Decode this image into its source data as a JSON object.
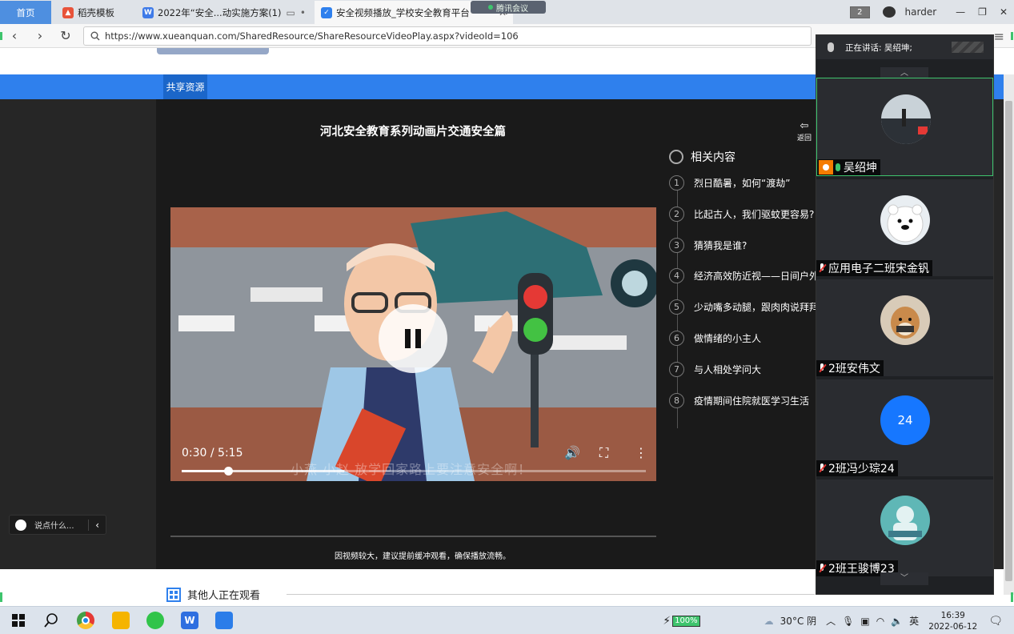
{
  "browser": {
    "tabs": [
      {
        "label": "首页",
        "kind": "home"
      },
      {
        "label": "稻壳模板",
        "kind": "normal"
      },
      {
        "label": "2022年“安全...动实施方案(1)",
        "kind": "normal"
      },
      {
        "label": "安全视频播放_学校安全教育平台",
        "kind": "active"
      }
    ],
    "meeting_pill": "腾讯会议",
    "window_count": "2",
    "user_name": "harder",
    "url": "https://www.xueanquan.com/SharedResource/ShareResourceVideoPlay.aspx?videoId=106"
  },
  "page": {
    "nav_label": "共享资源",
    "video_title": "河北安全教育系列动画片交通安全篇",
    "back_label": "返回",
    "video": {
      "time": "0:30 / 5:15",
      "progress": 0.1,
      "buffered": 0.35,
      "subtitle": "小燕 小赵 放学回家路上要注意安全啊！"
    },
    "related": {
      "heading": "相关内容",
      "items": [
        {
          "n": "1",
          "title": "烈日酷暑，如何“渡劫”"
        },
        {
          "n": "2",
          "title": "比起古人，我们驱蚊更容易?"
        },
        {
          "n": "3",
          "title": "猜猜我是谁?"
        },
        {
          "n": "4",
          "title": "经济高效防近视——日间户外活动"
        },
        {
          "n": "5",
          "title": "少动嘴多动腿，跟肉肉说拜拜"
        },
        {
          "n": "6",
          "title": "做情绪的小主人"
        },
        {
          "n": "7",
          "title": "与人相处学问大"
        },
        {
          "n": "8",
          "title": "疫情期间住院就医学习生活"
        }
      ]
    },
    "buffer_tip": "因视频较大，建议提前缓冲观看，确保播放流畅。",
    "chat_placeholder": "说点什么...",
    "others_watching": "其他人正在观看"
  },
  "meeting": {
    "speaking_label": "正在讲话: 吴绍坤;",
    "participants": [
      {
        "name": "吴绍坤",
        "speaking": true,
        "host": true,
        "avatar": "photo-seaside"
      },
      {
        "name": "应用电子二班宋金钒",
        "speaking": false,
        "avatar": "bear"
      },
      {
        "name": "2班安伟文",
        "speaking": false,
        "avatar": "dog"
      },
      {
        "name": "2班冯少琮24",
        "speaking": false,
        "avatar": "number",
        "avatar_text": "24"
      },
      {
        "name": "2班王骏博23",
        "speaking": false,
        "avatar": "doctor"
      }
    ]
  },
  "taskbar": {
    "battery": "100%",
    "weather": "30°C 阴",
    "ime": "英",
    "time": "16:39",
    "date": "2022-06-12"
  },
  "colors": {
    "accent_blue": "#2f80ed",
    "meeting_green": "#3ec46d",
    "dark_bg": "#262626"
  }
}
